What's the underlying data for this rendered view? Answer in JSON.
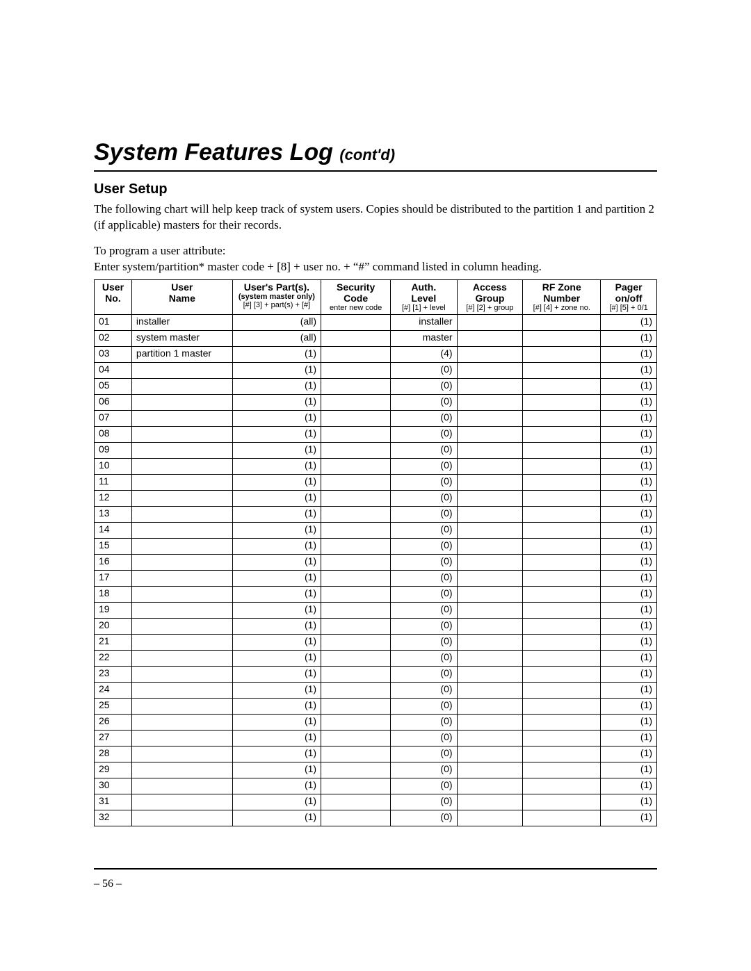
{
  "title_main": "System Features Log ",
  "title_contd": "(cont'd)",
  "subtitle": "User Setup",
  "para1": "The following chart will help keep track of system users. Copies should be distributed to the partition 1 and partition 2 (if applicable) masters for their records.",
  "para2a": "To program a user attribute:",
  "para2b": "Enter system/partition* master code + [8] + user no. + “#” command listed in column heading.",
  "page_number": "– 56 –",
  "headers": {
    "no": {
      "l1": "User",
      "l2": "No.",
      "note": ""
    },
    "name": {
      "l1": "User",
      "l2": "Name",
      "note": ""
    },
    "parts": {
      "l1": "User's Part(s).",
      "l2": "(system master only)",
      "note": "[#] [3] + part(s) + [#]"
    },
    "code": {
      "l1": "Security",
      "l2": "Code",
      "note": "enter new code"
    },
    "auth": {
      "l1": "Auth.",
      "l2": "Level",
      "note": "[#] [1] + level"
    },
    "group": {
      "l1": "Access",
      "l2": "Group",
      "note": "[#] [2] + group"
    },
    "rf": {
      "l1": "RF Zone",
      "l2": "Number",
      "note": "[#] [4] + zone no."
    },
    "pager": {
      "l1": "Pager",
      "l2": "on/off",
      "note": "[#] [5] + 0/1"
    }
  },
  "rows": [
    {
      "no": "01",
      "name": "installer",
      "parts": "(all)",
      "code": "",
      "auth": "installer",
      "group": "",
      "rf": "",
      "pager": "(1)"
    },
    {
      "no": "02",
      "name": "system master",
      "parts": "(all)",
      "code": "",
      "auth": "master",
      "group": "",
      "rf": "",
      "pager": "(1)"
    },
    {
      "no": "03",
      "name": "partition 1 master",
      "parts": "(1)",
      "code": "",
      "auth": "(4)",
      "group": "",
      "rf": "",
      "pager": "(1)"
    },
    {
      "no": "04",
      "name": "",
      "parts": "(1)",
      "code": "",
      "auth": "(0)",
      "group": "",
      "rf": "",
      "pager": "(1)"
    },
    {
      "no": "05",
      "name": "",
      "parts": "(1)",
      "code": "",
      "auth": "(0)",
      "group": "",
      "rf": "",
      "pager": "(1)"
    },
    {
      "no": "06",
      "name": "",
      "parts": "(1)",
      "code": "",
      "auth": "(0)",
      "group": "",
      "rf": "",
      "pager": "(1)"
    },
    {
      "no": "07",
      "name": "",
      "parts": "(1)",
      "code": "",
      "auth": "(0)",
      "group": "",
      "rf": "",
      "pager": "(1)"
    },
    {
      "no": "08",
      "name": "",
      "parts": "(1)",
      "code": "",
      "auth": "(0)",
      "group": "",
      "rf": "",
      "pager": "(1)"
    },
    {
      "no": "09",
      "name": "",
      "parts": "(1)",
      "code": "",
      "auth": "(0)",
      "group": "",
      "rf": "",
      "pager": "(1)"
    },
    {
      "no": "10",
      "name": "",
      "parts": "(1)",
      "code": "",
      "auth": "(0)",
      "group": "",
      "rf": "",
      "pager": "(1)"
    },
    {
      "no": "11",
      "name": "",
      "parts": "(1)",
      "code": "",
      "auth": "(0)",
      "group": "",
      "rf": "",
      "pager": "(1)"
    },
    {
      "no": "12",
      "name": "",
      "parts": "(1)",
      "code": "",
      "auth": "(0)",
      "group": "",
      "rf": "",
      "pager": "(1)"
    },
    {
      "no": "13",
      "name": "",
      "parts": "(1)",
      "code": "",
      "auth": "(0)",
      "group": "",
      "rf": "",
      "pager": "(1)"
    },
    {
      "no": "14",
      "name": "",
      "parts": "(1)",
      "code": "",
      "auth": "(0)",
      "group": "",
      "rf": "",
      "pager": "(1)"
    },
    {
      "no": "15",
      "name": "",
      "parts": "(1)",
      "code": "",
      "auth": "(0)",
      "group": "",
      "rf": "",
      "pager": "(1)"
    },
    {
      "no": "16",
      "name": "",
      "parts": "(1)",
      "code": "",
      "auth": "(0)",
      "group": "",
      "rf": "",
      "pager": "(1)"
    },
    {
      "no": "17",
      "name": "",
      "parts": "(1)",
      "code": "",
      "auth": "(0)",
      "group": "",
      "rf": "",
      "pager": "(1)"
    },
    {
      "no": "18",
      "name": "",
      "parts": "(1)",
      "code": "",
      "auth": "(0)",
      "group": "",
      "rf": "",
      "pager": "(1)"
    },
    {
      "no": "19",
      "name": "",
      "parts": "(1)",
      "code": "",
      "auth": "(0)",
      "group": "",
      "rf": "",
      "pager": "(1)"
    },
    {
      "no": "20",
      "name": "",
      "parts": "(1)",
      "code": "",
      "auth": "(0)",
      "group": "",
      "rf": "",
      "pager": "(1)"
    },
    {
      "no": "21",
      "name": "",
      "parts": "(1)",
      "code": "",
      "auth": "(0)",
      "group": "",
      "rf": "",
      "pager": "(1)"
    },
    {
      "no": "22",
      "name": "",
      "parts": "(1)",
      "code": "",
      "auth": "(0)",
      "group": "",
      "rf": "",
      "pager": "(1)"
    },
    {
      "no": "23",
      "name": "",
      "parts": "(1)",
      "code": "",
      "auth": "(0)",
      "group": "",
      "rf": "",
      "pager": "(1)"
    },
    {
      "no": "24",
      "name": "",
      "parts": "(1)",
      "code": "",
      "auth": "(0)",
      "group": "",
      "rf": "",
      "pager": "(1)"
    },
    {
      "no": "25",
      "name": "",
      "parts": "(1)",
      "code": "",
      "auth": "(0)",
      "group": "",
      "rf": "",
      "pager": "(1)"
    },
    {
      "no": "26",
      "name": "",
      "parts": "(1)",
      "code": "",
      "auth": "(0)",
      "group": "",
      "rf": "",
      "pager": "(1)"
    },
    {
      "no": "27",
      "name": "",
      "parts": "(1)",
      "code": "",
      "auth": "(0)",
      "group": "",
      "rf": "",
      "pager": "(1)"
    },
    {
      "no": "28",
      "name": "",
      "parts": "(1)",
      "code": "",
      "auth": "(0)",
      "group": "",
      "rf": "",
      "pager": "(1)"
    },
    {
      "no": "29",
      "name": "",
      "parts": "(1)",
      "code": "",
      "auth": "(0)",
      "group": "",
      "rf": "",
      "pager": "(1)"
    },
    {
      "no": "30",
      "name": "",
      "parts": "(1)",
      "code": "",
      "auth": "(0)",
      "group": "",
      "rf": "",
      "pager": "(1)"
    },
    {
      "no": "31",
      "name": "",
      "parts": "(1)",
      "code": "",
      "auth": "(0)",
      "group": "",
      "rf": "",
      "pager": "(1)"
    },
    {
      "no": "32",
      "name": "",
      "parts": "(1)",
      "code": "",
      "auth": "(0)",
      "group": "",
      "rf": "",
      "pager": "(1)"
    }
  ]
}
